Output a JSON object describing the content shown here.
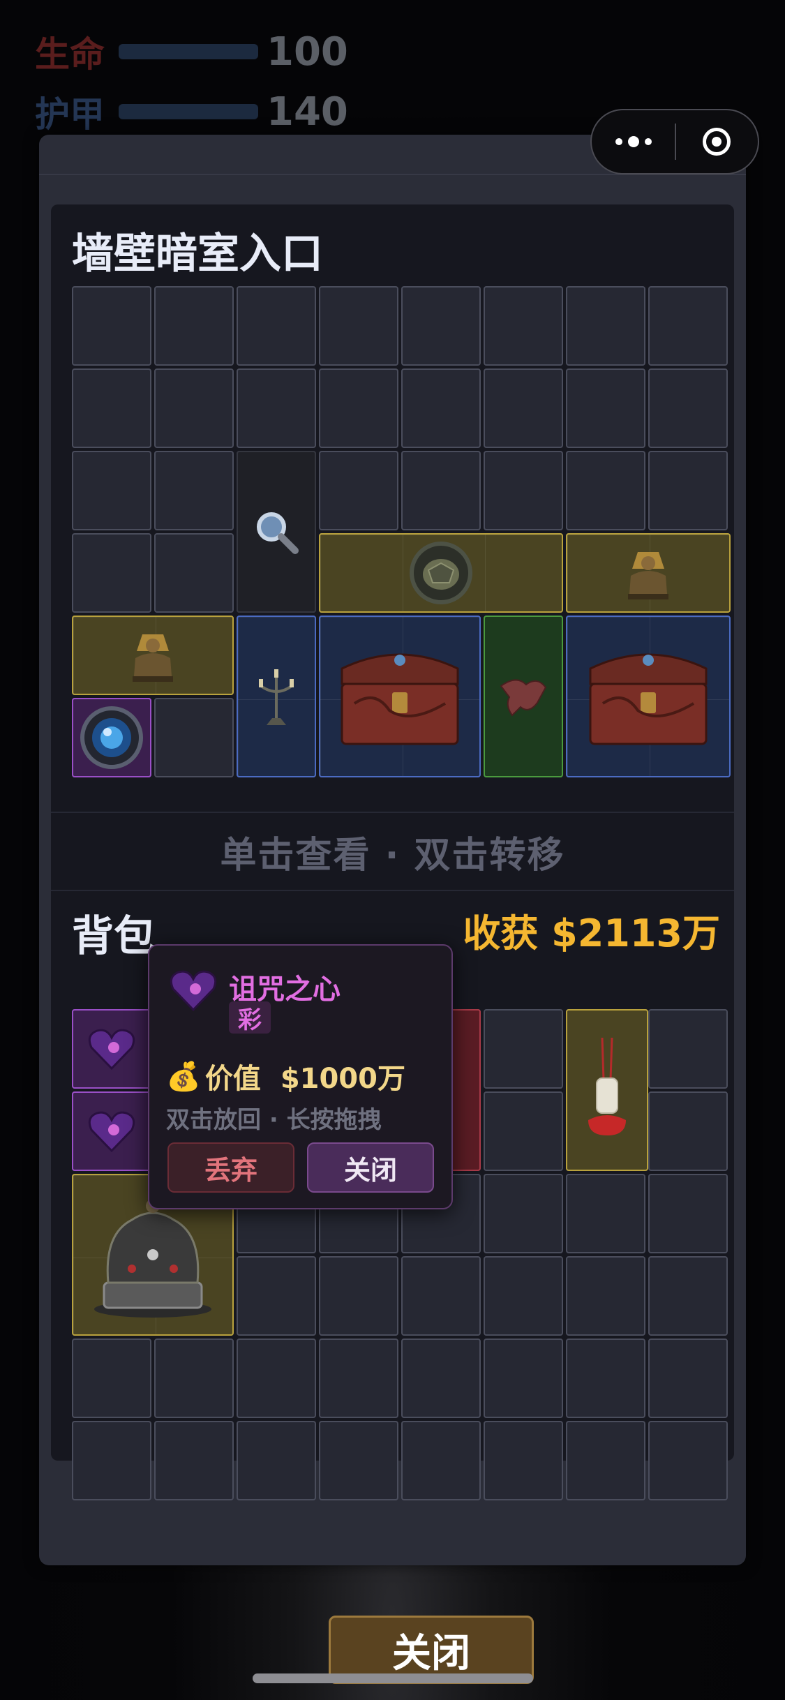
{
  "hud": {
    "hp_label": "生命",
    "hp_value": "100",
    "armor_label": "护甲",
    "armor_value": "140"
  },
  "capsule": {
    "more_icon": "more-dots-icon",
    "close_icon": "target-circle-icon"
  },
  "container": {
    "title": "墙壁暗室入口",
    "hint": "单击查看 · 双击转移",
    "search_icon": "🔍"
  },
  "backpack": {
    "title": "背包",
    "loot_label": "收获 $2113万"
  },
  "popup": {
    "name": "诅咒之心",
    "rarity": "彩",
    "value_label": "价值",
    "value_amount": "$1000万",
    "money_icon": "💰",
    "tip": "双击放回 · 长按拖拽",
    "discard": "丢弃",
    "close": "关闭"
  },
  "close_button": "关闭",
  "colors": {
    "gold": "#b9a23d",
    "blue": "#4b6bc2",
    "green": "#4a9a3e",
    "purple": "#9a4fc7",
    "red": "#a83a48",
    "loot": "#f5b731",
    "rarity_magenta": "#e26ee2"
  }
}
